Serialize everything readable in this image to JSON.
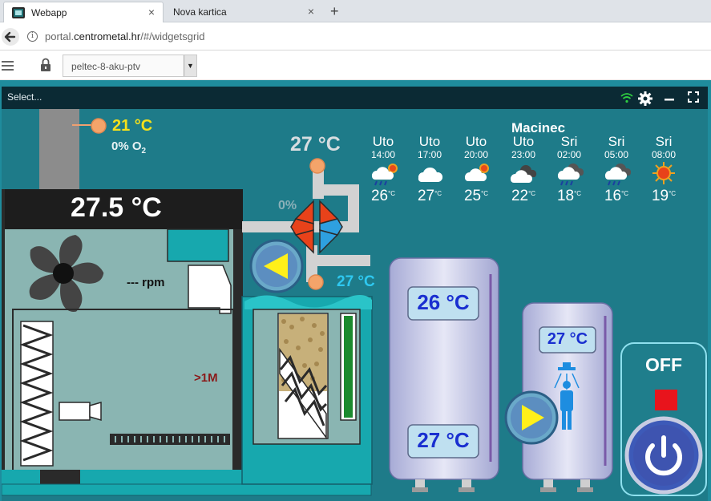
{
  "browser": {
    "tabs": [
      {
        "label": "Webapp",
        "close": "×"
      },
      {
        "label": "Nova kartica",
        "close": "×"
      }
    ],
    "new_tab": "+",
    "url_prefix": "portal.",
    "url_host": "centrometal.hr",
    "url_path": "/#/widgetsgrid"
  },
  "toolbar": {
    "device_selected": "peltec-8-aku-ptv"
  },
  "widget": {
    "select_label": "Select..."
  },
  "boiler": {
    "flue_temp": "21 °C",
    "o2_prefix": "0% O",
    "o2_sub": "2",
    "boiler_temp": "27.5 °C",
    "fan_rpm": "--- rpm",
    "runtime": ">1M"
  },
  "mixing": {
    "supply_temp": "27 °C",
    "valve_pct": "0%",
    "return_temp": "27 °C"
  },
  "weather": {
    "location": "Macinec",
    "forecast": [
      {
        "day": "Uto",
        "time": "14:00",
        "icon": "rain-sun-cloud-icon",
        "temp": "26",
        "unit": "°C"
      },
      {
        "day": "Uto",
        "time": "17:00",
        "icon": "cloud-icon",
        "temp": "27",
        "unit": "°C"
      },
      {
        "day": "Uto",
        "time": "20:00",
        "icon": "sun-cloud-icon",
        "temp": "25",
        "unit": "°C"
      },
      {
        "day": "Uto",
        "time": "23:00",
        "icon": "dark-cloud-icon",
        "temp": "22",
        "unit": "°C"
      },
      {
        "day": "Sri",
        "time": "02:00",
        "icon": "rain-cloud-icon",
        "temp": "18",
        "unit": "°C"
      },
      {
        "day": "Sri",
        "time": "05:00",
        "icon": "rain-cloud-icon",
        "temp": "16",
        "unit": "°C"
      },
      {
        "day": "Sri",
        "time": "08:00",
        "icon": "sun-icon",
        "temp": "19",
        "unit": "°C"
      }
    ]
  },
  "accumulator": {
    "top_temp": "26 °C",
    "bottom_temp": "27 °C"
  },
  "dhw": {
    "temp": "27 °C"
  },
  "power": {
    "state": "OFF"
  },
  "colors": {
    "panel": "#1e7b89",
    "boiler_body": "#8ab5b2",
    "orange_sensor": "#f0a070",
    "yellow_text": "#f5e11a",
    "cyan_text": "#2ec8f0",
    "tank_temp_text": "#1a2fd0",
    "off_red": "#e8141c"
  }
}
